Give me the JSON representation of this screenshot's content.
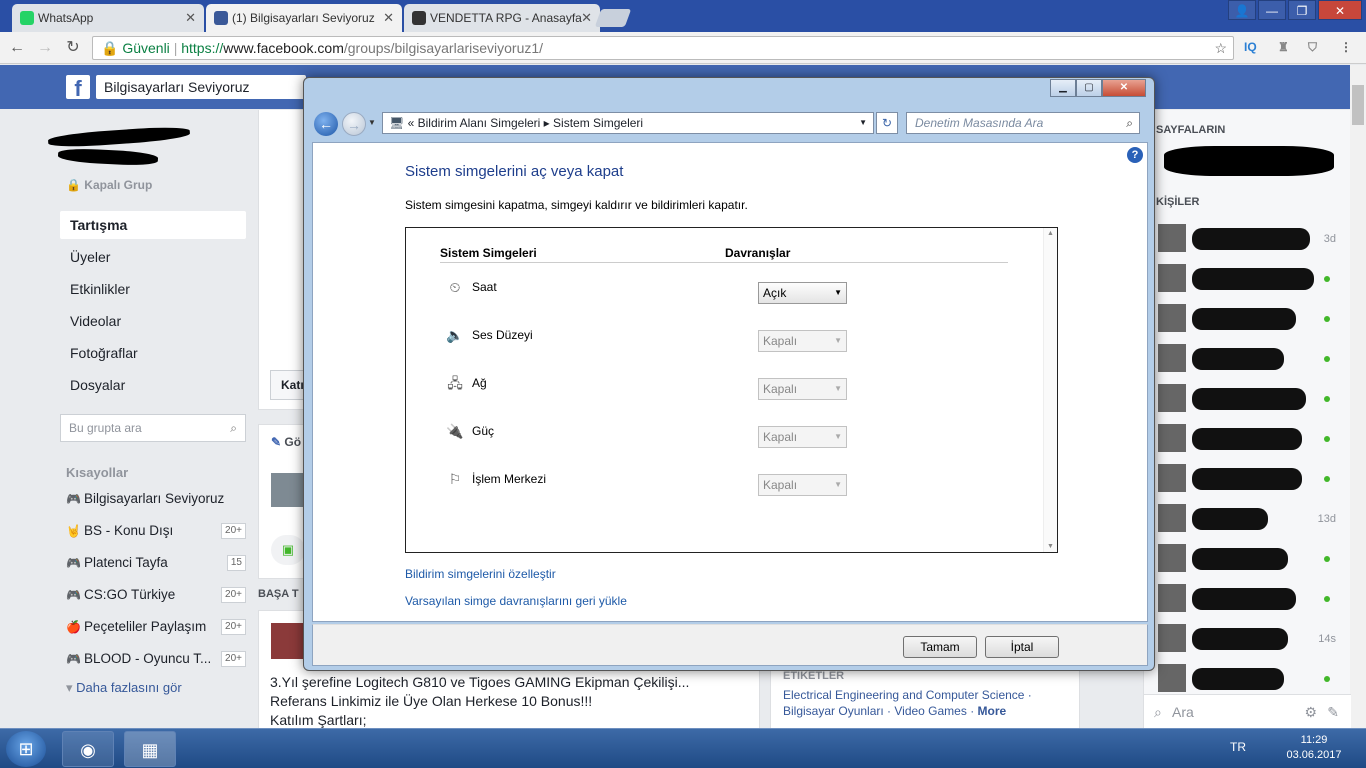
{
  "browser": {
    "tabs": [
      {
        "title": "WhatsApp",
        "favicon_color": "#25d366"
      },
      {
        "title": "(1) Bilgisayarları Seviyoruz",
        "favicon_color": "#3b5998"
      },
      {
        "title": "VENDETTA RPG - Anasayfa",
        "favicon_color": "#333333"
      }
    ],
    "secure_label": "Güvenli",
    "url_scheme": "https://",
    "url_host": "www.facebook.com",
    "url_path": "/groups/bilgisayarlariseviyoruz1/",
    "ext_iq": "IQ"
  },
  "facebook": {
    "logo": "f",
    "search_value": "Bilgisayarları Seviyoruz",
    "group_privacy": "Kapalı Grup",
    "nav": [
      "Tartışma",
      "Üyeler",
      "Etkinlikler",
      "Videolar",
      "Fotoğraflar",
      "Dosyalar"
    ],
    "group_search_placeholder": "Bu grupta ara",
    "shortcuts_title": "Kısayollar",
    "shortcuts": [
      {
        "label": "Bilgisayarları Seviyoruz",
        "icon": "gamepad-icon",
        "glyph": "🎮",
        "count": ""
      },
      {
        "label": "BS - Konu Dışı",
        "icon": "rock-hand-icon",
        "glyph": "🤘",
        "count": "20+"
      },
      {
        "label": "Platenci Tayfa",
        "icon": "gamepad-icon",
        "glyph": "🎮",
        "count": "15"
      },
      {
        "label": "CS:GO Türkiye",
        "icon": "gamepad-icon",
        "glyph": "🎮",
        "count": "20+"
      },
      {
        "label": "Peçeteliler Paylaşım",
        "icon": "apple-icon",
        "glyph": "🍎",
        "count": "20+"
      },
      {
        "label": "BLOOD - Oyuncu T...",
        "icon": "gamepad-icon",
        "glyph": "🎮",
        "count": "20+"
      }
    ],
    "see_more": "Daha fazlasını gör",
    "join_partial": "Katı",
    "post_partial": "Gö",
    "top_partial": "BAŞA T",
    "post_lines": [
      "3.Yıl şerefine Logitech G810 ve Tigoes GAMING Ekipman Çekilişi...",
      "Referans Linkimiz ile Üye Olan Herkese 10 Bonus!!!",
      "Katılım Şartları;"
    ],
    "tags_title": "ETİKETLER",
    "tags_line1": "Electrical Engineering and Computer Science ·",
    "tags_line2a": "Bilgisayar Oyunları · Video Games ·",
    "tags_more": "More",
    "chat_pages_title": "SAYFALARIN",
    "chat_people_title": "KİŞİLER",
    "chat_rows": [
      {
        "time": "3d",
        "online": false
      },
      {
        "time": "",
        "online": true
      },
      {
        "time": "",
        "online": true
      },
      {
        "time": "",
        "online": true
      },
      {
        "time": "",
        "online": true
      },
      {
        "time": "",
        "online": true
      },
      {
        "time": "",
        "online": true
      },
      {
        "time": "13d",
        "online": false
      },
      {
        "time": "",
        "online": true
      },
      {
        "time": "",
        "online": true
      },
      {
        "time": "14s",
        "online": false
      },
      {
        "time": "",
        "online": true
      }
    ],
    "chat_search": "Ara"
  },
  "dialog": {
    "breadcrumb_prefix": "«",
    "breadcrumb_1": "Bildirim Alanı Simgeleri",
    "breadcrumb_sep": "▸",
    "breadcrumb_2": "Sistem Simgeleri",
    "search_placeholder": "Denetim Masasında Ara",
    "title": "Sistem simgelerini aç veya kapat",
    "description": "Sistem simgesini kapatma, simgeyi kaldırır ve bildirimleri kapatır.",
    "col_icons": "Sistem Simgeleri",
    "col_behaviors": "Davranışlar",
    "rows": [
      {
        "label": "Saat",
        "value": "Açık",
        "enabled": true,
        "icon": "clock-icon",
        "glyph": "⏲"
      },
      {
        "label": "Ses Düzeyi",
        "value": "Kapalı",
        "enabled": false,
        "icon": "speaker-icon",
        "glyph": "🔈"
      },
      {
        "label": "Ağ",
        "value": "Kapalı",
        "enabled": false,
        "icon": "network-icon",
        "glyph": "🖧"
      },
      {
        "label": "Güç",
        "value": "Kapalı",
        "enabled": false,
        "icon": "power-icon",
        "glyph": "🔌"
      },
      {
        "label": "İşlem Merkezi",
        "value": "Kapalı",
        "enabled": false,
        "icon": "flag-icon",
        "glyph": "⚐"
      }
    ],
    "link_customize": "Bildirim simgelerini özelleştir",
    "link_restore": "Varsayılan simge davranışlarını geri yükle",
    "ok_label": "Tamam",
    "cancel_label": "İptal"
  },
  "taskbar": {
    "language": "TR",
    "time": "11:29",
    "date": "03.06.2017"
  }
}
